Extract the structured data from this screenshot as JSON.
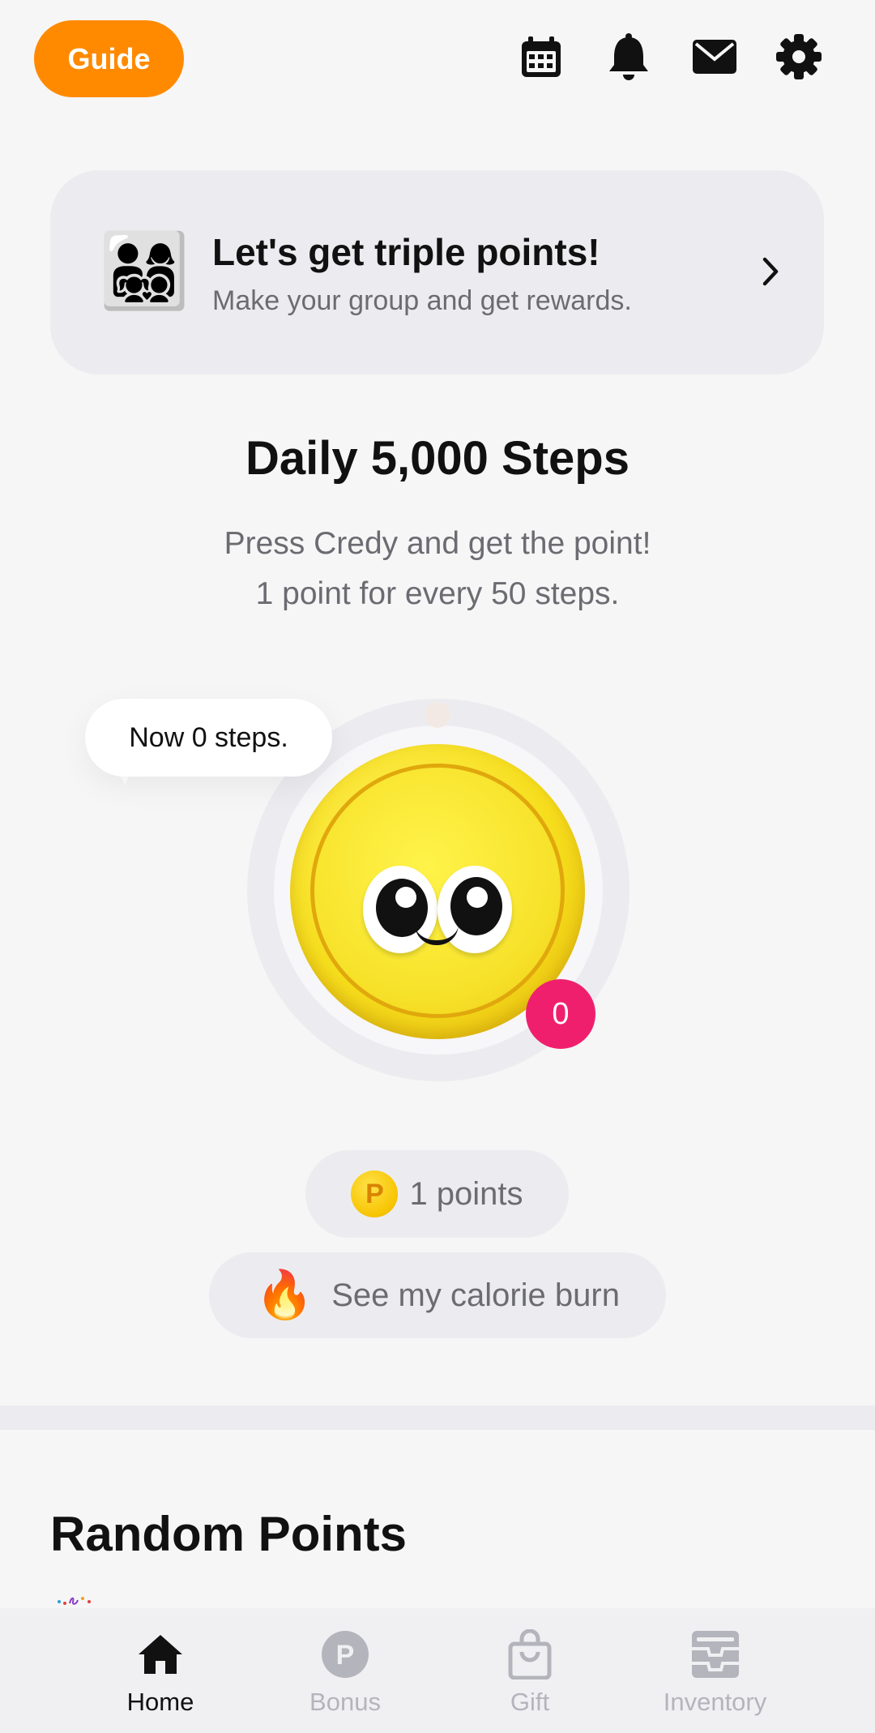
{
  "header": {
    "guide_label": "Guide",
    "icons": [
      "calendar-icon",
      "bell-icon",
      "mail-icon",
      "gear-icon"
    ]
  },
  "promo": {
    "emoji": "👨‍👩‍👧‍👦",
    "title": "Let's get triple points!",
    "subtitle": "Make your group and get rewards."
  },
  "steps": {
    "title": "Daily 5,000 Steps",
    "line1": "Press Credy and get the point!",
    "line2": "1 point for every 50 steps.",
    "bubble": "Now 0 steps.",
    "count": "0"
  },
  "points": {
    "coin_letter": "P",
    "label": "1 points",
    "calorie_emoji": "🔥",
    "calorie_label": "See my calorie burn"
  },
  "random": {
    "title": "Random Points"
  },
  "nav": {
    "items": [
      {
        "label": "Home",
        "icon": "home-icon",
        "active": true
      },
      {
        "label": "Bonus",
        "icon": "bonus-icon",
        "active": false
      },
      {
        "label": "Gift",
        "icon": "gift-bag-icon",
        "active": false
      },
      {
        "label": "Inventory",
        "icon": "inventory-icon",
        "active": false
      }
    ]
  },
  "colors": {
    "accent": "#ff8a00",
    "badge": "#f01f6e",
    "coin": "#f6de1d"
  }
}
